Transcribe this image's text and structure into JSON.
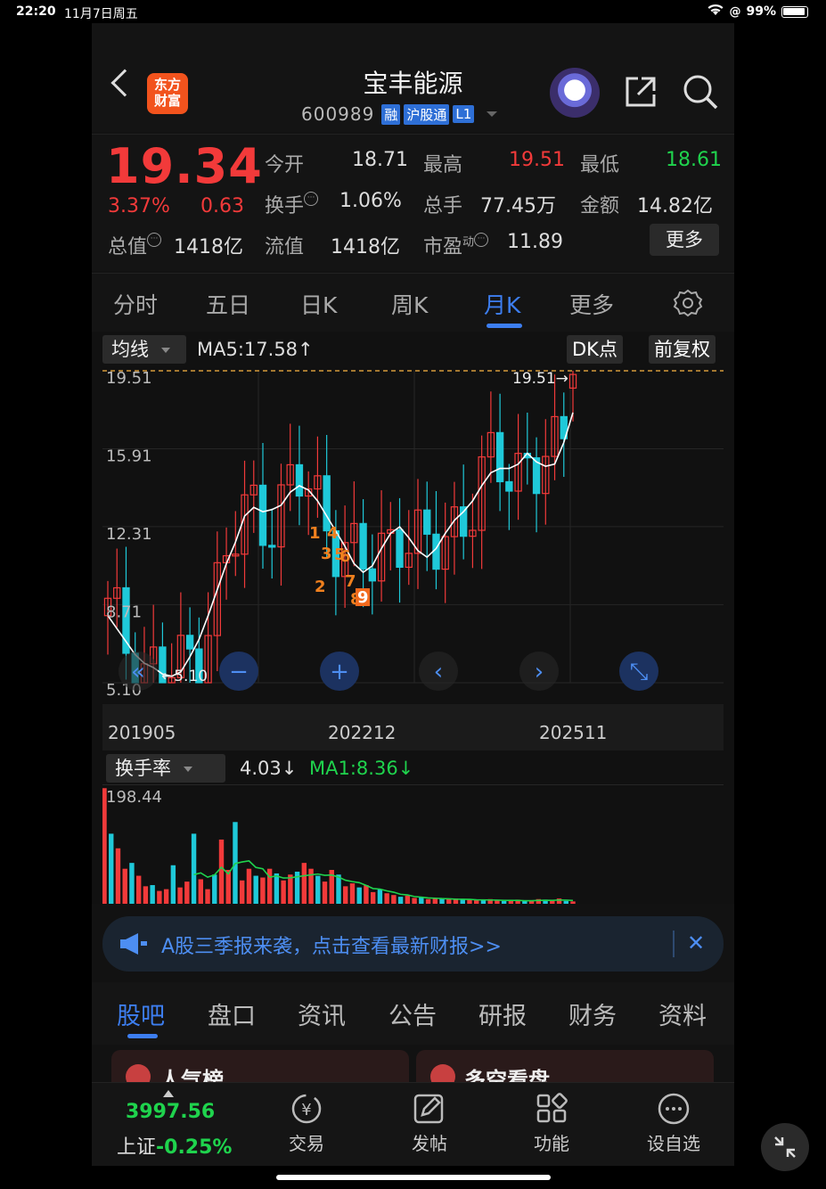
{
  "status": {
    "time": "22:20",
    "date": "11月7日周五",
    "battery": "99%"
  },
  "header": {
    "logo": "东方财富",
    "title": "宝丰能源",
    "code": "600989",
    "tags": [
      "融",
      "沪股通",
      "L1"
    ]
  },
  "quote": {
    "price": "19.34",
    "change_pct": "3.37%",
    "change": "0.63",
    "open_label": "今开",
    "open": "18.71",
    "high_label": "最高",
    "high": "19.51",
    "low_label": "最低",
    "low": "18.61",
    "turnover_label": "换手",
    "turnover": "1.06%",
    "volume_label": "总手",
    "volume": "77.45万",
    "amount_label": "金额",
    "amount": "14.82亿",
    "mcap_label": "总值",
    "mcap": "1418亿",
    "float_label": "流值",
    "float": "1418亿",
    "pe_label": "市盈",
    "pe_sup": "动",
    "pe": "11.89",
    "more": "更多"
  },
  "chart_tabs": [
    "分时",
    "五日",
    "日K",
    "周K",
    "月K",
    "更多"
  ],
  "active_tab": "月K",
  "chart_controls": {
    "indicator": "均线",
    "ma5": "MA5:17.58↑",
    "dk": "DK点",
    "adjust": "前复权"
  },
  "chart_data": [
    {
      "type": "candlestick",
      "title": "",
      "period": "monthly",
      "y_ticks": [
        "19.51",
        "15.91",
        "12.31",
        "8.71",
        "5.10"
      ],
      "ylim": [
        5.1,
        19.51
      ],
      "x_labels": [
        "201905",
        "202212",
        "202511"
      ],
      "max_marker": "19.51→",
      "min_marker": "←5.10",
      "dk_markers": [
        "1",
        "2",
        "3",
        "4",
        "5",
        "6",
        "7",
        "8",
        "9"
      ],
      "series": [
        {
          "name": "MA5",
          "values": [
            8.2,
            7.6,
            7.0,
            6.4,
            6.0,
            5.8,
            5.5,
            5.4,
            5.6,
            6.3,
            7.1,
            8.2,
            9.4,
            10.6,
            11.6,
            12.8,
            13.2,
            13.0,
            13.1,
            13.3,
            13.9,
            14.2,
            14.0,
            13.5,
            12.8,
            12.1,
            11.4,
            10.6,
            10.2,
            10.5,
            11.3,
            12.0,
            12.3,
            11.8,
            11.2,
            10.9,
            11.3,
            12.0,
            12.6,
            13.0,
            13.5,
            14.2,
            14.8,
            15.0,
            15.0,
            15.2,
            15.7,
            15.3,
            15.1,
            15.2,
            16.2,
            17.58
          ]
        }
      ]
    },
    {
      "type": "bar",
      "title": "",
      "indicator": "换手率",
      "value": "4.03↓",
      "ma1": "MA1:8.36↓",
      "y_ticks": [
        "198.44"
      ],
      "ylim": [
        0,
        198.44
      ],
      "values": [
        198,
        120,
        95,
        60,
        70,
        48,
        30,
        32,
        22,
        25,
        66,
        28,
        38,
        120,
        42,
        25,
        50,
        110,
        58,
        140,
        40,
        60,
        48,
        45,
        60,
        52,
        40,
        50,
        55,
        70,
        60,
        48,
        38,
        58,
        50,
        30,
        35,
        28,
        32,
        20,
        25,
        18,
        15,
        12,
        14,
        10,
        12,
        8,
        9,
        10,
        8,
        9,
        7,
        8,
        6,
        7,
        8,
        6,
        5,
        6,
        7,
        5,
        6,
        8,
        7,
        6,
        9,
        5,
        4.03
      ],
      "colors": {
        "up": "#f23a3a",
        "down": "#1fc9d9",
        "ma": "#1fd34d"
      }
    }
  ],
  "banner": {
    "text": "A股三季报来袭，点击查看最新财报>>",
    "close": "✕"
  },
  "news_tabs": [
    "股吧",
    "盘口",
    "资讯",
    "公告",
    "研报",
    "财务",
    "资料"
  ],
  "cards": [
    "人气榜",
    "多空看盘"
  ],
  "bottom": {
    "index_value": "3997.56",
    "index_name": "上证",
    "index_pct": "-0.25%",
    "nav": [
      "交易",
      "发帖",
      "功能",
      "设自选"
    ]
  },
  "colors": {
    "up": "#f23a3a",
    "down": "#1fd34d",
    "accent": "#3d7ef0",
    "cyan": "#1fc9d9"
  }
}
